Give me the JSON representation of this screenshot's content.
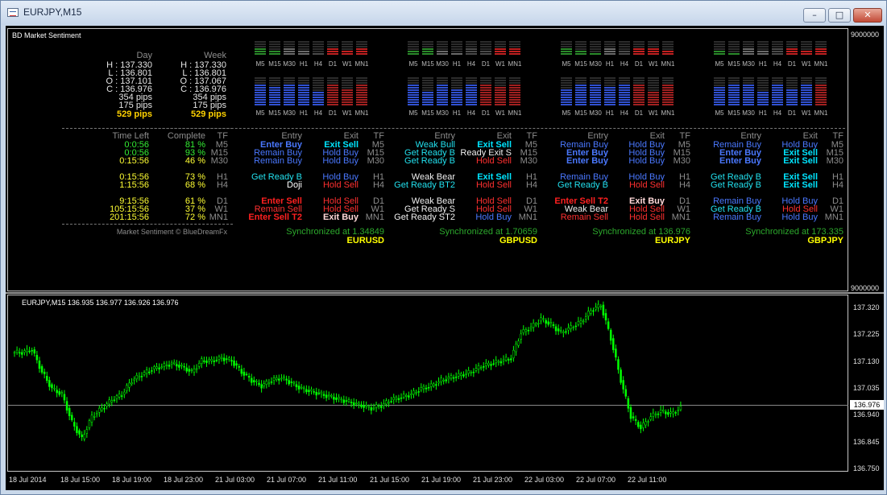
{
  "window": {
    "title": "EURJPY,M15",
    "min": "–",
    "max": "□",
    "close": "✕"
  },
  "indicator": {
    "name": "BD Market Sentiment",
    "axis_top": "9000000",
    "axis_bottom": "9000000",
    "stats": {
      "day_label": "Day",
      "week_label": "Week",
      "day": [
        "H : 137.330",
        "L : 136.801",
        "O : 137.101",
        "C : 136.976",
        "354 pips",
        "175 pips"
      ],
      "day_total": "529 pips",
      "week": [
        "H : 137.330",
        "L : 136.801",
        "O : 137.067",
        "C : 136.976",
        "354 pips",
        "175 pips"
      ],
      "week_total": "529 pips"
    },
    "timeframes": [
      "M5",
      "M15",
      "M30",
      "H1",
      "H4",
      "D1",
      "W1",
      "MN1"
    ],
    "timers": {
      "headers": [
        "Time Left",
        "Complete",
        "TF"
      ],
      "rows": [
        {
          "left": "0:0:56",
          "pct": "81 %",
          "tf": "M5"
        },
        {
          "left": "0:0:56",
          "pct": "93 %",
          "tf": "M15"
        },
        {
          "left": "0:15:56",
          "pct": "46 %",
          "tf": "M30"
        },
        {
          "left": "0:15:56",
          "pct": "73 %",
          "tf": "H1"
        },
        {
          "left": "1:15:56",
          "pct": "68 %",
          "tf": "H4"
        },
        {
          "left": "9:15:56",
          "pct": "61 %",
          "tf": "D1"
        },
        {
          "left": "105:15:56",
          "pct": "37 %",
          "tf": "W1"
        },
        {
          "left": "201:15:56",
          "pct": "72 %",
          "tf": "MN1"
        }
      ],
      "copyright": "Market Sentiment © BlueDreamFx"
    },
    "pair_headers": [
      "Entry",
      "Exit",
      "TF"
    ],
    "pairs": [
      {
        "name": "EURUSD",
        "sync": "Synchronized at 1.34849",
        "entry": [
          "Enter Buy",
          "Remain Buy",
          "Remain Buy",
          "Get Ready B",
          "Doji",
          "Enter Sell",
          "Remain Sell",
          "Enter Sell T2"
        ],
        "exit": [
          "Exit Sell",
          "Hold Buy",
          "Hold Buy",
          "Hold Buy",
          "Hold Sell",
          "Hold Sell",
          "Hold Sell",
          "Exit Buy"
        ]
      },
      {
        "name": "GBPUSD",
        "sync": "Synchronized at 1.70659",
        "entry": [
          "Weak Bull",
          "Get Ready B",
          "Get Ready B",
          "Weak Bear",
          "Get Ready BT2",
          "Weak Bear",
          "Get Ready S",
          "Get Ready ST2"
        ],
        "exit": [
          "Exit Sell",
          "Ready Exit S",
          "Hold Sell",
          "Exit Sell",
          "Hold Sell",
          "Hold Sell",
          "Hold Sell",
          "Hold Buy"
        ]
      },
      {
        "name": "EURJPY",
        "sync": "Synchronized at 136.976",
        "entry": [
          "Remain Buy",
          "Enter Buy",
          "Enter Buy",
          "Remain Buy",
          "Get Ready B",
          "Enter Sell T2",
          "Weak Bear",
          "Remain Sell"
        ],
        "exit": [
          "Hold Buy",
          "Hold Buy",
          "Hold Buy",
          "Hold Buy",
          "Hold Sell",
          "Exit Buy",
          "Hold Sell",
          "Hold Sell"
        ]
      },
      {
        "name": "GBPJPY",
        "sync": "Synchronized at 173.335",
        "entry": [
          "Remain Buy",
          "Enter Buy",
          "Enter Buy",
          "Get Ready B",
          "Get Ready B",
          "Remain Buy",
          "Get Ready B",
          "Remain Buy"
        ],
        "exit": [
          "Hold Buy",
          "Exit Sell",
          "Exit Sell",
          "Exit Sell",
          "Exit Sell",
          "Hold Buy",
          "Hold Sell",
          "Hold Buy"
        ]
      }
    ]
  },
  "price_chart": {
    "info": "EURJPY,M15  136.935 136.977 136.926 136.976",
    "current_price": "136.976",
    "y_labels": [
      "137.320",
      "137.225",
      "137.130",
      "137.035",
      "136.940",
      "136.845",
      "136.750"
    ],
    "x_labels": [
      "18 Jul 2014",
      "18 Jul 15:00",
      "18 Jul 19:00",
      "18 Jul 23:00",
      "21 Jul 03:00",
      "21 Jul 07:00",
      "21 Jul 11:00",
      "21 Jul 15:00",
      "21 Jul 19:00",
      "21 Jul 23:00",
      "22 Jul 03:00",
      "22 Jul 07:00",
      "22 Jul 11:00"
    ],
    "candle_color": "#00ff00",
    "closes": [
      137.15,
      137.16,
      137.08,
      137.02,
      137.0,
      136.9,
      136.84,
      136.92,
      136.95,
      136.98,
      137.0,
      137.05,
      137.07,
      137.09,
      137.1,
      137.11,
      137.1,
      137.08,
      137.12,
      137.12,
      137.13,
      137.12,
      137.08,
      137.05,
      137.03,
      137.05,
      137.06,
      137.04,
      137.02,
      137.01,
      137.0,
      136.99,
      136.98,
      136.97,
      136.96,
      136.95,
      136.96,
      136.98,
      136.99,
      137.0,
      137.02,
      137.03,
      137.05,
      137.06,
      137.07,
      137.08,
      137.1,
      137.11,
      137.12,
      137.13,
      137.22,
      137.24,
      137.27,
      137.25,
      137.22,
      137.24,
      137.26,
      137.3,
      137.32,
      137.2,
      137.05,
      136.92,
      136.88,
      136.92,
      136.94,
      136.93,
      136.95
    ]
  }
}
